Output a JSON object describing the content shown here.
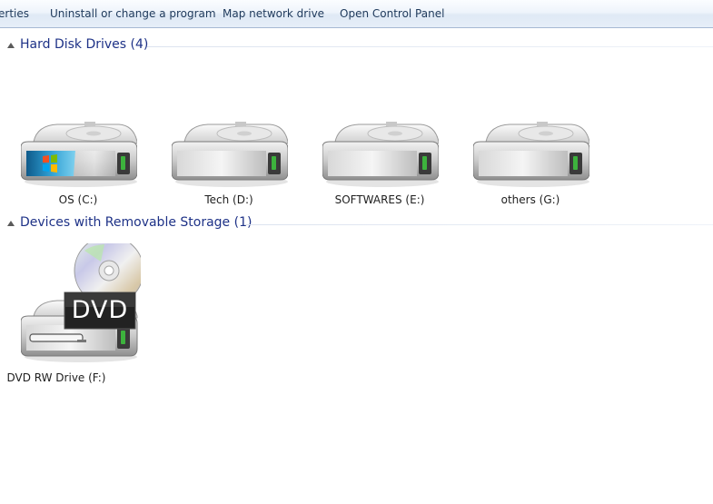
{
  "toolbar": {
    "items": [
      {
        "label": "erties"
      },
      {
        "label": "Uninstall or change a program"
      },
      {
        "label": "Map network drive"
      },
      {
        "label": "Open Control Panel"
      }
    ]
  },
  "groups": [
    {
      "title": "Hard Disk Drives (4)",
      "drives": [
        {
          "label": "OS (C:)",
          "icon": "hard-drive-windows-icon"
        },
        {
          "label": "Tech (D:)",
          "icon": "hard-drive-icon"
        },
        {
          "label": "SOFTWARES (E:)",
          "icon": "hard-drive-icon"
        },
        {
          "label": "others (G:)",
          "icon": "hard-drive-icon"
        }
      ]
    },
    {
      "title": "Devices with Removable Storage (1)",
      "drives": [
        {
          "label": "DVD RW Drive (F:)",
          "icon": "dvd-drive-icon",
          "badge": "DVD"
        }
      ]
    }
  ],
  "colors": {
    "group_title": "#1e3287",
    "toolbar_text": "#1e395b",
    "drive_led": "#3db33d"
  }
}
